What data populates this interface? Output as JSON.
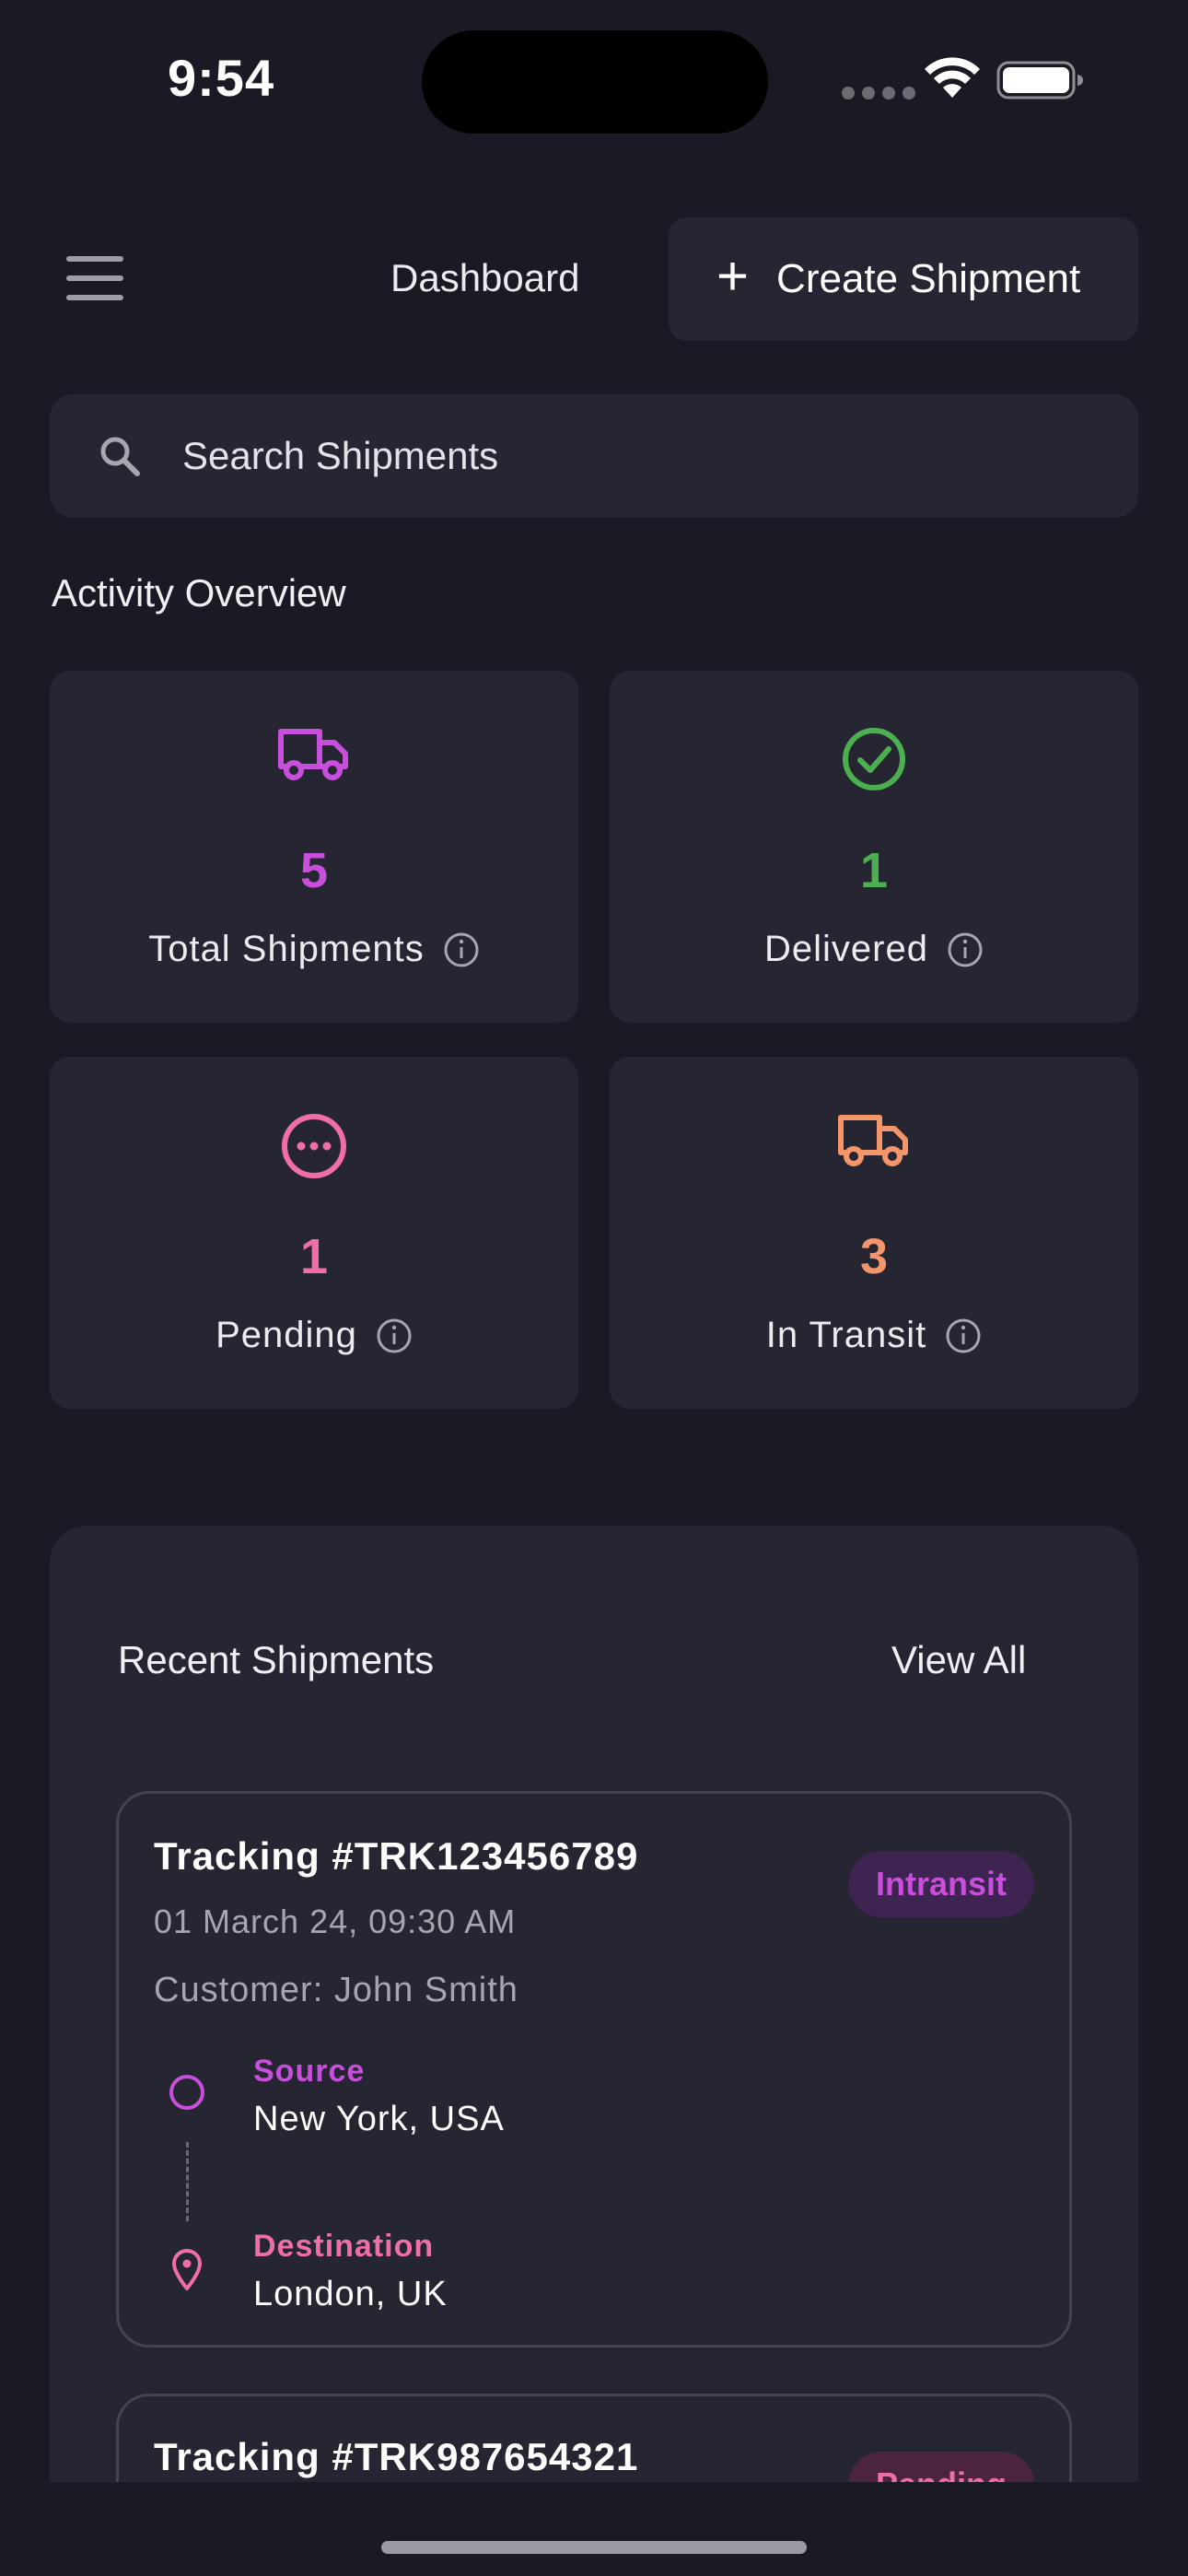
{
  "status_bar": {
    "time": "9:54"
  },
  "header": {
    "title": "Dashboard",
    "create_button_label": "Create Shipment"
  },
  "search": {
    "placeholder": "Search Shipments"
  },
  "overview": {
    "title": "Activity Overview",
    "stats": [
      {
        "value": "5",
        "label": "Total Shipments",
        "color": "#c74fdc",
        "icon": "truck-icon"
      },
      {
        "value": "1",
        "label": "Delivered",
        "color": "#4caf50",
        "icon": "check-circle-icon"
      },
      {
        "value": "1",
        "label": "Pending",
        "color": "#f06ea6",
        "icon": "more-circle-icon"
      },
      {
        "value": "3",
        "label": "In Transit",
        "color": "#f5956a",
        "icon": "truck-icon"
      }
    ]
  },
  "recent": {
    "title": "Recent Shipments",
    "view_all_label": "View All",
    "shipments": [
      {
        "tracking": "Tracking #TRK123456789",
        "date": "01 March 24, 09:30 AM",
        "customer": "Customer: John Smith",
        "status": "Intransit",
        "source_label": "Source",
        "source": "New York, USA",
        "destination_label": "Destination",
        "destination": "London, UK"
      },
      {
        "tracking": "Tracking #TRK987654321",
        "status": "Pending"
      }
    ]
  },
  "colors": {
    "background": "#1a1a24",
    "card": "#262633",
    "accent_purple": "#c74fdc",
    "accent_pink": "#f06ea6",
    "accent_green": "#4caf50",
    "accent_orange": "#f5956a"
  }
}
